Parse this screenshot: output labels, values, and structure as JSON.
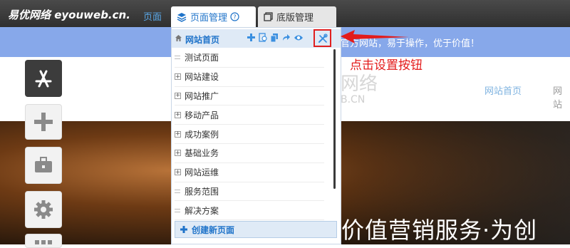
{
  "toolbar": {
    "brand": "易优网络 eyouweb.cn.",
    "page_link": "页面",
    "tab_page_manage": "页面管理",
    "tab_template_manage": "底版管理"
  },
  "notice": {
    "text": "官方网站，易于操作，优于价值！"
  },
  "site": {
    "logo_cn": "网络",
    "logo_en": "B.CN",
    "nav_home": "网站首页",
    "nav_next": "网站",
    "hero_text": "价值营销服务·为创"
  },
  "panel": {
    "home_label": "网站首页",
    "pages": [
      {
        "label": "测试页面",
        "expandable": false
      },
      {
        "label": "网站建设",
        "expandable": true
      },
      {
        "label": "网站推广",
        "expandable": true
      },
      {
        "label": "移动产品",
        "expandable": true
      },
      {
        "label": "成功案例",
        "expandable": true
      },
      {
        "label": "基础业务",
        "expandable": true
      },
      {
        "label": "网站运维",
        "expandable": true
      },
      {
        "label": "服务范围",
        "expandable": false
      },
      {
        "label": "解决方案",
        "expandable": false
      }
    ],
    "create_label": "创建新页面"
  },
  "annotation": {
    "text": "点击设置按钮"
  },
  "colors": {
    "accent_blue": "#1f73c9",
    "notice_blue": "#87a8ea",
    "annotation_red": "#e31b1b"
  }
}
